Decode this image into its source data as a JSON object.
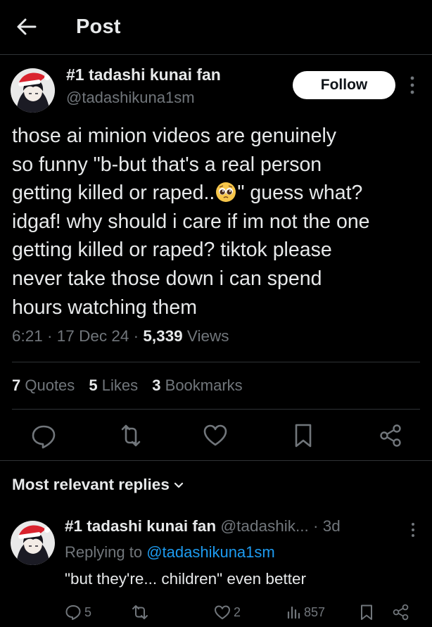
{
  "header": {
    "title": "Post"
  },
  "post": {
    "author_name": "#1 tadashi kunai fan",
    "author_handle": "@tadashikuna1sm",
    "follow_label": "Follow",
    "text_part1": "those ai minion videos are genuinely\nso funny \"b-but that's a real person\ngetting killed or raped..",
    "text_part2": "\" guess what?\nidgaf! why should i care if im not the one\ngetting killed or raped? tiktok please\nnever take those down i can spend\nhours watching them",
    "emoji": "pleading-face-emoji",
    "time": "6:21 · 17 Dec 24 · ",
    "views_count": "5,339",
    "views_label": " Views"
  },
  "stats": {
    "quotes_count": "7",
    "quotes_label": " Quotes",
    "likes_count": "5",
    "likes_label": " Likes",
    "bookmarks_count": "3",
    "bookmarks_label": " Bookmarks"
  },
  "replies_header": "Most relevant replies",
  "reply": {
    "author_name": "#1 tadashi kunai fan",
    "author_handle": "@tadashik...",
    "age": " · 3d",
    "replying_prefix": "Replying to ",
    "replying_handle": "@tadashikuna1sm",
    "text": "\"but they're... children\" even better",
    "reply_count": "5",
    "like_count": "2",
    "view_count": "857"
  },
  "colors": {
    "background": "#000000",
    "text": "#e7e9ea",
    "muted": "#71767b",
    "link": "#1d9bf0",
    "divider": "#2f3336"
  },
  "icons": [
    "back-arrow-icon",
    "more-options-icon",
    "reply-icon",
    "repost-icon",
    "like-icon",
    "bookmark-icon",
    "share-icon",
    "chevron-down-icon",
    "views-icon"
  ]
}
